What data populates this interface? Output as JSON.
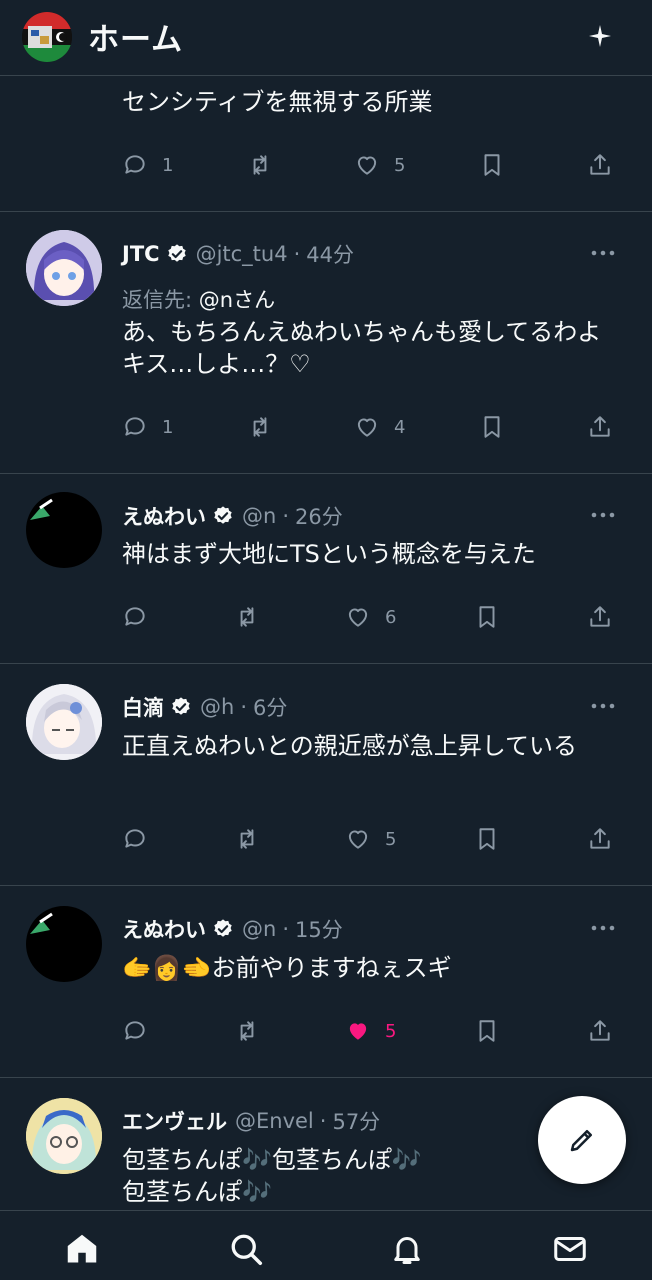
{
  "header": {
    "title": "ホーム",
    "avatar_icon": "flag-avatar-icon",
    "sparkle_icon": "sparkle-icon"
  },
  "tweets": [
    {
      "body": "センシティブを無視する所業",
      "replies": "1",
      "retweets": "",
      "likes": "5",
      "liked": false
    },
    {
      "name": "JTC",
      "handle": "@jtc_tu4",
      "time": "44分",
      "reply_prefix": "返信先: ",
      "reply_handle": "@nさん",
      "body": "あ、もちろんえぬわいちゃんも愛してるわよキス…しよ…？♡",
      "replies": "1",
      "retweets": "",
      "likes": "4",
      "liked": false
    },
    {
      "name": "えぬわい",
      "handle": "@n",
      "time": "26分",
      "body": "神はまず大地にTSという概念を与えた",
      "replies": "",
      "retweets": "",
      "likes": "6",
      "liked": false
    },
    {
      "name": "白滴",
      "handle": "@h",
      "time": "6分",
      "body": "正直えぬわいとの親近感が急上昇している",
      "replies": "",
      "retweets": "",
      "likes": "5",
      "liked": false
    },
    {
      "name": "えぬわい",
      "handle": "@n",
      "time": "15分",
      "body": "🫱👩🫲お前やりますねぇスギ",
      "replies": "",
      "retweets": "",
      "likes": "5",
      "liked": true
    },
    {
      "name": "エンヴェル",
      "handle": "@Envel",
      "time": "57分",
      "body": "包茎ちんぽ🎶包茎ちんぽ🎶\n包茎ちんぽ🎶",
      "replies": "",
      "retweets": "",
      "likes": "",
      "liked": false
    }
  ],
  "sep": "·",
  "icons": {
    "reply": "reply-icon",
    "retweet": "retweet-icon",
    "like": "heart-icon",
    "bookmark": "bookmark-icon",
    "share": "share-icon",
    "more": "more-icon",
    "verified": "verified-badge-icon"
  },
  "fab": {
    "icon": "compose-icon"
  },
  "nav": [
    "home-icon",
    "search-icon",
    "notifications-icon",
    "messages-icon"
  ],
  "colors": {
    "background": "#15202b",
    "border": "#38444d",
    "secondary_text": "#8b98a5",
    "like_active": "#f91880"
  }
}
